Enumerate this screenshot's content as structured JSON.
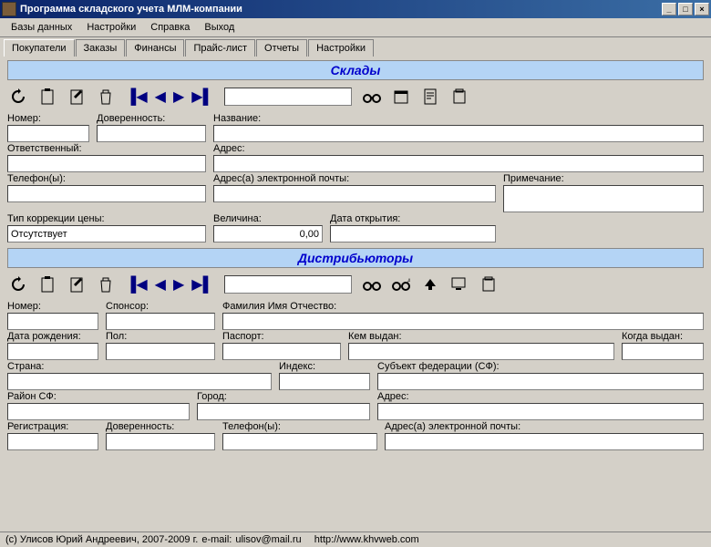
{
  "title": "Программа складского учета МЛМ-компании",
  "menu": {
    "databases": "Базы данных",
    "settings": "Настройки",
    "help": "Справка",
    "exit": "Выход"
  },
  "tabs": {
    "buyers": "Покупатели",
    "orders": "Заказы",
    "finance": "Финансы",
    "pricelist": "Прайс-лист",
    "reports": "Отчеты",
    "settings": "Настройки"
  },
  "sections": {
    "warehouses": {
      "title": "Склады",
      "fields": {
        "number": "Номер:",
        "proxy": "Доверенность:",
        "name": "Название:",
        "responsible": "Ответственный:",
        "address": "Адрес:",
        "phones": "Телефон(ы):",
        "emails": "Адрес(а) электронной почты:",
        "note": "Примечание:",
        "pricecorr": "Тип коррекции цены:",
        "pricecorr_value": "Отсутствует",
        "amount": "Величина:",
        "amount_value": "0,00",
        "opendate": "Дата открытия:"
      }
    },
    "distributors": {
      "title": "Дистрибьюторы",
      "fields": {
        "number": "Номер:",
        "sponsor": "Спонсор:",
        "fio": "Фамилия Имя Отчество:",
        "birthdate": "Дата рождения:",
        "sex": "Пол:",
        "passport": "Паспорт:",
        "issuedby": "Кем выдан:",
        "issuedwhen": "Когда выдан:",
        "country": "Страна:",
        "index": "Индекс:",
        "subject": "Субъект федерации (СФ):",
        "district": "Район СФ:",
        "city": "Город:",
        "address": "Адрес:",
        "registration": "Регистрация:",
        "proxy": "Доверенность:",
        "phones": "Телефон(ы):",
        "emails": "Адрес(а) электронной почты:"
      }
    }
  },
  "status": {
    "copyright": "(с) Улисов Юрий Андреевич, 2007-2009 г.",
    "email_label": "e-mail:",
    "email": "ulisov@mail.ru",
    "url": "http://www.khvweb.com"
  }
}
